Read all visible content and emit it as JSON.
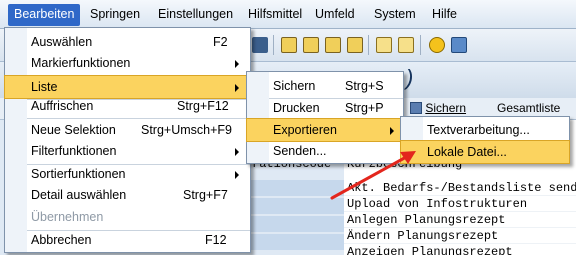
{
  "menubar": {
    "items": [
      "Bearbeiten",
      "Springen",
      "Einstellungen",
      "Hilfsmittel",
      "Umfeld",
      "System",
      "Hilfe"
    ]
  },
  "app_toolbar": {
    "save_label": "Sichern",
    "total_label": "Gesamtliste"
  },
  "list": {
    "column_header_left": "rationscode",
    "column_header_right": "Kurzbeschreibung",
    "rows": [
      "Akt. Bedarfs-/Bestandsliste senden",
      "Upload von Infostrukturen",
      "Anlegen Planungsrezept",
      "Ändern Planungsrezept",
      "Anzeigen Planungsrezept"
    ]
  },
  "menu_bearbeiten": {
    "items": [
      {
        "label": "Auswählen",
        "shortcut": "F2"
      },
      {
        "label": "Markierfunktionen",
        "submenu": true
      },
      {
        "label": "Liste",
        "submenu": true
      },
      {
        "label": "Auffrischen",
        "shortcut": "Strg+F12"
      },
      {
        "label": "Neue Selektion",
        "shortcut": "Strg+Umsch+F9"
      },
      {
        "label": "Filterfunktionen",
        "submenu": true
      },
      {
        "label": "Sortierfunktionen",
        "submenu": true
      },
      {
        "label": "Detail auswählen",
        "shortcut": "Strg+F7"
      },
      {
        "label": "Übernehmen"
      },
      {
        "label": "Abbrechen",
        "shortcut": "F12"
      }
    ]
  },
  "menu_liste": {
    "items": [
      {
        "label": "Sichern",
        "shortcut": "Strg+S"
      },
      {
        "label": "Drucken",
        "shortcut": "Strg+P"
      },
      {
        "label": "Exportieren",
        "submenu": true
      },
      {
        "label": "Senden..."
      }
    ]
  },
  "menu_exportieren": {
    "items": [
      {
        "label": "Textverarbeitung..."
      },
      {
        "label": "Lokale Datei..."
      }
    ]
  },
  "colors": {
    "menu_highlight": "#fbd35f",
    "menubar_active": "#2f68c8",
    "arrow": "#e3261d"
  }
}
